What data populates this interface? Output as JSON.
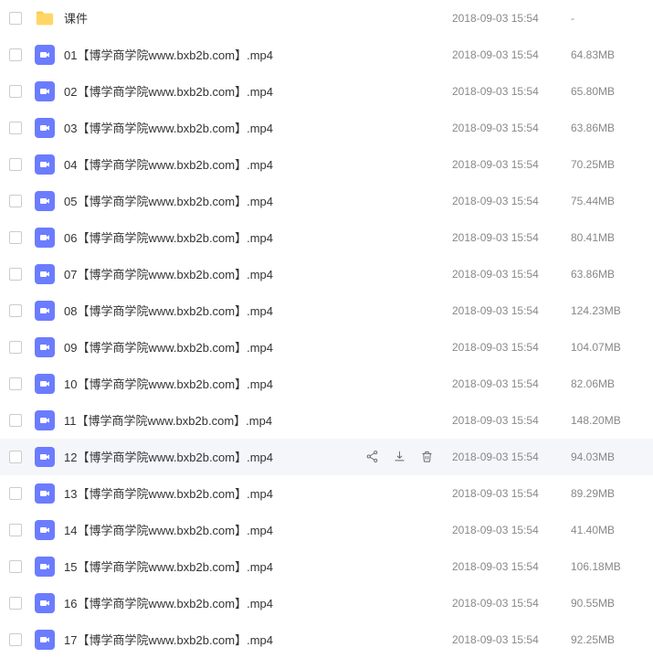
{
  "hovered_index": 12,
  "files": [
    {
      "type": "folder",
      "name": "课件",
      "date": "2018-09-03 15:54",
      "size": "-"
    },
    {
      "type": "video",
      "name": "01【博学商学院www.bxb2b.com】.mp4",
      "date": "2018-09-03 15:54",
      "size": "64.83MB"
    },
    {
      "type": "video",
      "name": "02【博学商学院www.bxb2b.com】.mp4",
      "date": "2018-09-03 15:54",
      "size": "65.80MB"
    },
    {
      "type": "video",
      "name": "03【博学商学院www.bxb2b.com】.mp4",
      "date": "2018-09-03 15:54",
      "size": "63.86MB"
    },
    {
      "type": "video",
      "name": "04【博学商学院www.bxb2b.com】.mp4",
      "date": "2018-09-03 15:54",
      "size": "70.25MB"
    },
    {
      "type": "video",
      "name": "05【博学商学院www.bxb2b.com】.mp4",
      "date": "2018-09-03 15:54",
      "size": "75.44MB"
    },
    {
      "type": "video",
      "name": "06【博学商学院www.bxb2b.com】.mp4",
      "date": "2018-09-03 15:54",
      "size": "80.41MB"
    },
    {
      "type": "video",
      "name": "07【博学商学院www.bxb2b.com】.mp4",
      "date": "2018-09-03 15:54",
      "size": "63.86MB"
    },
    {
      "type": "video",
      "name": "08【博学商学院www.bxb2b.com】.mp4",
      "date": "2018-09-03 15:54",
      "size": "124.23MB"
    },
    {
      "type": "video",
      "name": "09【博学商学院www.bxb2b.com】.mp4",
      "date": "2018-09-03 15:54",
      "size": "104.07MB"
    },
    {
      "type": "video",
      "name": "10【博学商学院www.bxb2b.com】.mp4",
      "date": "2018-09-03 15:54",
      "size": "82.06MB"
    },
    {
      "type": "video",
      "name": "11【博学商学院www.bxb2b.com】.mp4",
      "date": "2018-09-03 15:54",
      "size": "148.20MB"
    },
    {
      "type": "video",
      "name": "12【博学商学院www.bxb2b.com】.mp4",
      "date": "2018-09-03 15:54",
      "size": "94.03MB"
    },
    {
      "type": "video",
      "name": "13【博学商学院www.bxb2b.com】.mp4",
      "date": "2018-09-03 15:54",
      "size": "89.29MB"
    },
    {
      "type": "video",
      "name": "14【博学商学院www.bxb2b.com】.mp4",
      "date": "2018-09-03 15:54",
      "size": "41.40MB"
    },
    {
      "type": "video",
      "name": "15【博学商学院www.bxb2b.com】.mp4",
      "date": "2018-09-03 15:54",
      "size": "106.18MB"
    },
    {
      "type": "video",
      "name": "16【博学商学院www.bxb2b.com】.mp4",
      "date": "2018-09-03 15:54",
      "size": "90.55MB"
    },
    {
      "type": "video",
      "name": "17【博学商学院www.bxb2b.com】.mp4",
      "date": "2018-09-03 15:54",
      "size": "92.25MB"
    }
  ]
}
